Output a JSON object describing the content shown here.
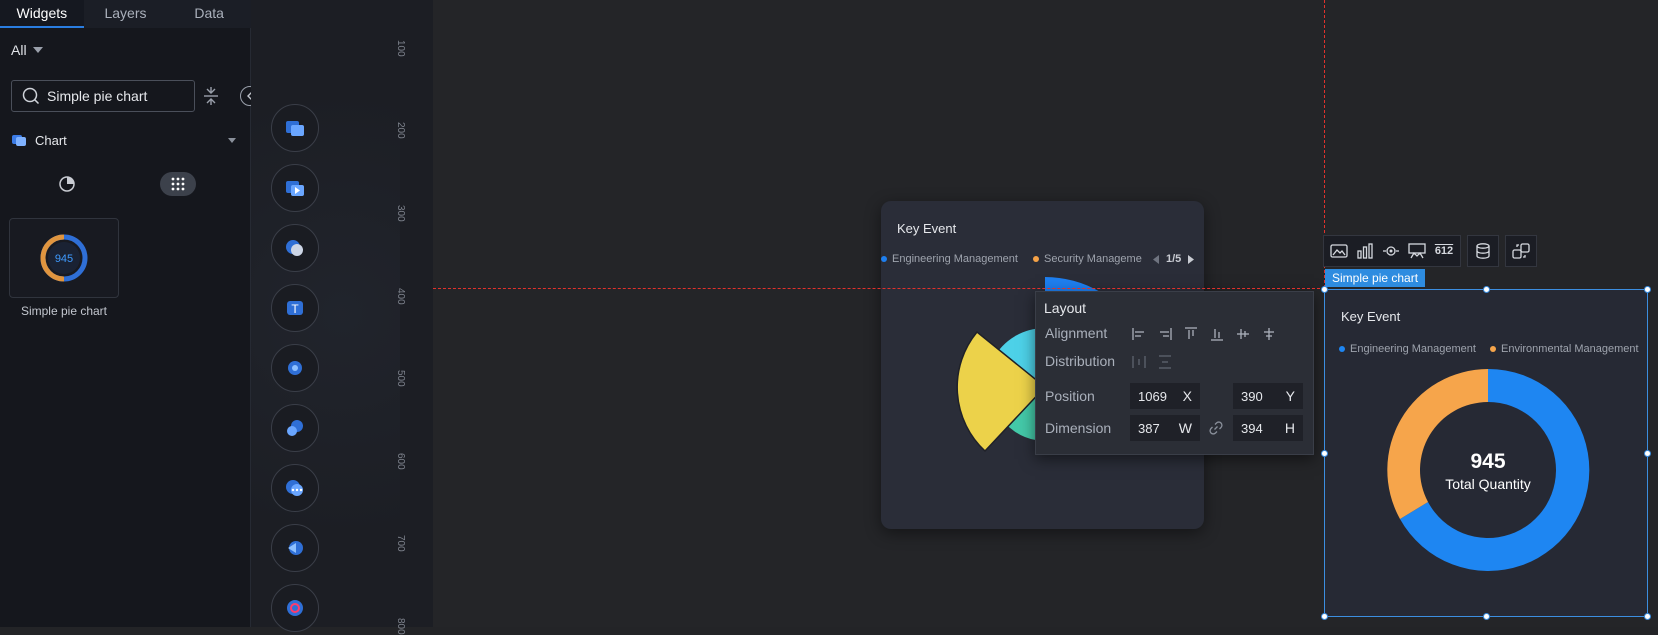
{
  "left_panel": {
    "tabs": [
      {
        "label": "Widgets"
      },
      {
        "label": "Layers"
      },
      {
        "label": "Data"
      }
    ],
    "filter": {
      "label": "All"
    },
    "search": {
      "value": "Simple pie chart",
      "placeholder": ""
    },
    "category": {
      "label": "Chart"
    },
    "widget": {
      "label": "Simple pie chart",
      "thumb_value": "945"
    }
  },
  "ruler": {
    "ticks": [
      "100",
      "200",
      "300",
      "400",
      "500",
      "600",
      "700",
      "800"
    ]
  },
  "card1": {
    "title": "Key Event",
    "legend": [
      {
        "label": "Engineering Management",
        "color": "#1e7ff0"
      },
      {
        "label": "Security Manageme",
        "color": "#f5a247"
      }
    ],
    "pager": "1/5",
    "chart_data": {
      "type": "pie",
      "slice_colors": [
        "#1e7ff0",
        "#4dd1e8",
        "#44c9a8",
        "#ecd24a"
      ]
    }
  },
  "layout_panel": {
    "title": "Layout",
    "alignment_label": "Alignment",
    "distribution_label": "Distribution",
    "position_label": "Position",
    "dimension_label": "Dimension",
    "x": "1069",
    "x_axis": "X",
    "y": "390",
    "y_axis": "Y",
    "w": "387",
    "w_axis": "W",
    "h": "394",
    "h_axis": "H"
  },
  "toolbar": {
    "counter": "612"
  },
  "selection_tag": "Simple pie chart",
  "card2": {
    "title": "Key Event",
    "legend": [
      {
        "label": "Engineering Management",
        "color": "#1e86f2"
      },
      {
        "label": "Environmental Management",
        "color": "#f6a54b"
      }
    ],
    "center_value": "945",
    "center_label": "Total Quantity",
    "chart_data": {
      "type": "pie",
      "colors": [
        "#1e86f2",
        "#f6a54b"
      ]
    }
  },
  "colors": {
    "accent": "#2a7de1",
    "guide": "#e0322c",
    "selection": "#3c8ee0"
  }
}
